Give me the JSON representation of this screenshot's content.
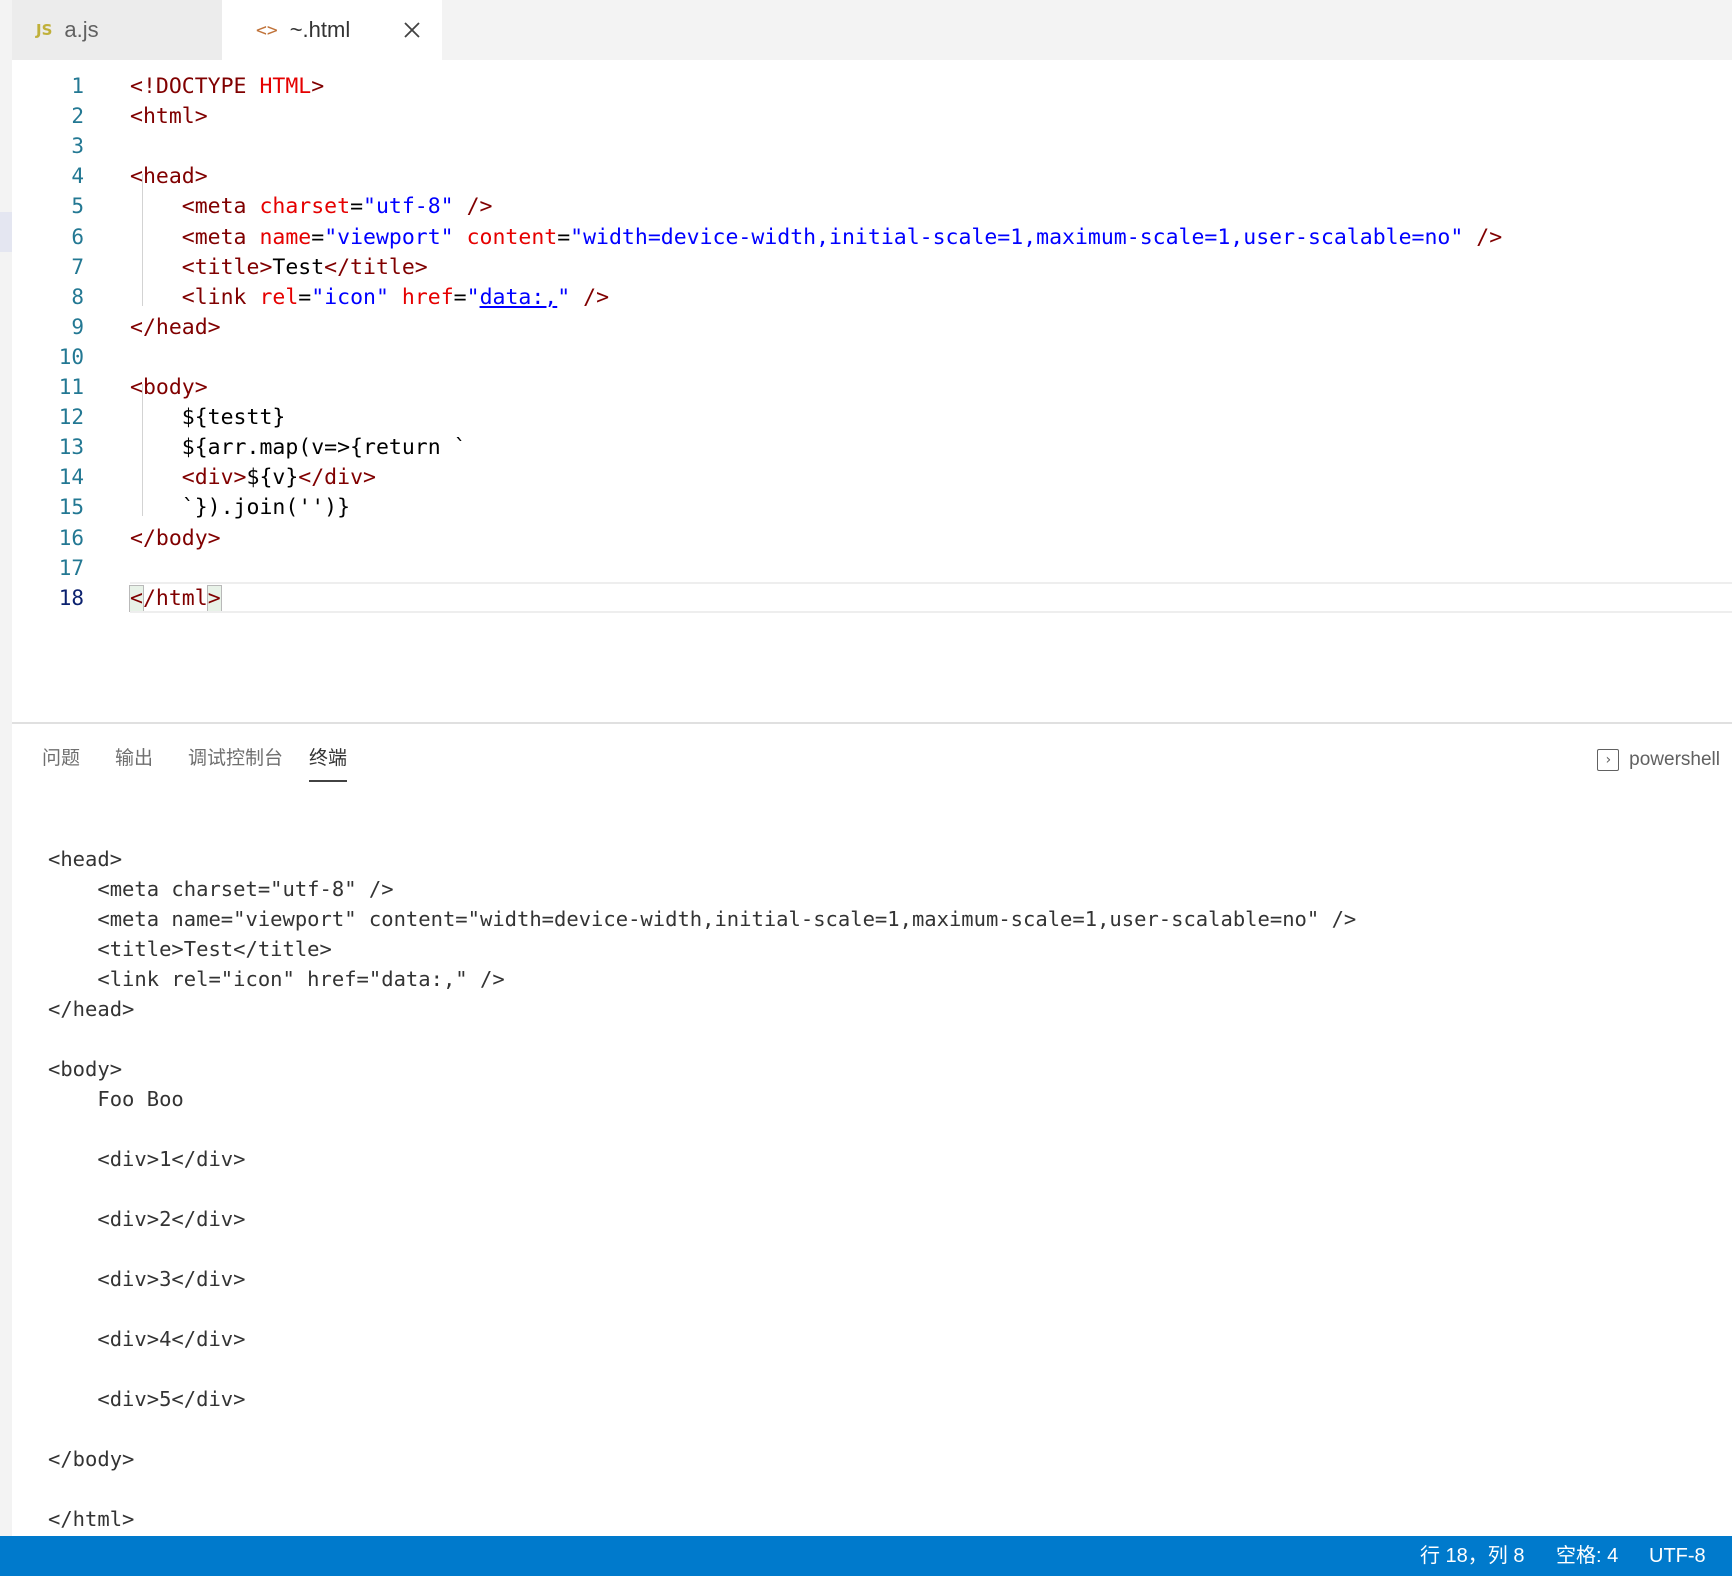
{
  "tabs": [
    {
      "label": "a.js",
      "icon_text": "JS",
      "icon": "javascript-file-icon"
    },
    {
      "label": "~.html",
      "icon_text": "<>",
      "icon": "html-file-icon",
      "close_icon": "close-icon"
    }
  ],
  "editor": {
    "lines": [
      {
        "n": "1",
        "tokens": [
          {
            "t": "<!DOCTYPE ",
            "c": "tag"
          },
          {
            "t": "HTML",
            "c": "attr"
          },
          {
            "t": ">",
            "c": "tag"
          }
        ]
      },
      {
        "n": "2",
        "tokens": [
          {
            "t": "<html>",
            "c": "tag"
          }
        ]
      },
      {
        "n": "3",
        "tokens": []
      },
      {
        "n": "4",
        "tokens": [
          {
            "t": "<head>",
            "c": "tag"
          }
        ]
      },
      {
        "n": "5",
        "tokens": [
          {
            "t": "    "
          },
          {
            "t": "<meta ",
            "c": "tag"
          },
          {
            "t": "charset",
            "c": "attr"
          },
          {
            "t": "="
          },
          {
            "t": "\"utf-8\"",
            "c": "val"
          },
          {
            "t": " />",
            "c": "tag"
          }
        ]
      },
      {
        "n": "6",
        "tokens": [
          {
            "t": "    "
          },
          {
            "t": "<meta ",
            "c": "tag"
          },
          {
            "t": "name",
            "c": "attr"
          },
          {
            "t": "="
          },
          {
            "t": "\"viewport\"",
            "c": "val"
          },
          {
            "t": " "
          },
          {
            "t": "content",
            "c": "attr"
          },
          {
            "t": "="
          },
          {
            "t": "\"width=device-width,initial-scale=1,maximum-scale=1,user-scalable=no\"",
            "c": "val"
          },
          {
            "t": " />",
            "c": "tag"
          }
        ]
      },
      {
        "n": "7",
        "tokens": [
          {
            "t": "    "
          },
          {
            "t": "<title>",
            "c": "tag"
          },
          {
            "t": "Test"
          },
          {
            "t": "</title>",
            "c": "tag"
          }
        ]
      },
      {
        "n": "8",
        "tokens": [
          {
            "t": "    "
          },
          {
            "t": "<link ",
            "c": "tag"
          },
          {
            "t": "rel",
            "c": "attr"
          },
          {
            "t": "="
          },
          {
            "t": "\"icon\"",
            "c": "val"
          },
          {
            "t": " "
          },
          {
            "t": "href",
            "c": "attr"
          },
          {
            "t": "="
          },
          {
            "t": "\"",
            "c": "val"
          },
          {
            "t": "data:,",
            "c": "link"
          },
          {
            "t": "\"",
            "c": "val"
          },
          {
            "t": " />",
            "c": "tag"
          }
        ]
      },
      {
        "n": "9",
        "tokens": [
          {
            "t": "</head>",
            "c": "tag"
          }
        ]
      },
      {
        "n": "10",
        "tokens": []
      },
      {
        "n": "11",
        "tokens": [
          {
            "t": "<body>",
            "c": "tag"
          }
        ]
      },
      {
        "n": "12",
        "tokens": [
          {
            "t": "    ${testt}"
          }
        ]
      },
      {
        "n": "13",
        "tokens": [
          {
            "t": "    ${arr.map(v=>{return `"
          }
        ]
      },
      {
        "n": "14",
        "tokens": [
          {
            "t": "    "
          },
          {
            "t": "<div>",
            "c": "tag"
          },
          {
            "t": "${v}"
          },
          {
            "t": "</div>",
            "c": "tag"
          }
        ]
      },
      {
        "n": "15",
        "tokens": [
          {
            "t": "    `}).join('')}"
          }
        ]
      },
      {
        "n": "16",
        "tokens": [
          {
            "t": "</body>",
            "c": "tag"
          }
        ]
      },
      {
        "n": "17",
        "tokens": []
      },
      {
        "n": "18",
        "tokens": [
          {
            "t": "<",
            "c": "tag",
            "m": true
          },
          {
            "t": "/html",
            "c": "tag"
          },
          {
            "t": ">",
            "c": "tag",
            "m": true
          }
        ],
        "current": true
      }
    ]
  },
  "panel": {
    "tabs": [
      "问题",
      "输出",
      "调试控制台",
      "终端"
    ],
    "active_tab": "终端",
    "shell_label": "powershell",
    "shell_icon": "terminal-icon",
    "terminal_lines": [
      "<head>",
      "    <meta charset=\"utf-8\" />",
      "    <meta name=\"viewport\" content=\"width=device-width,initial-scale=1,maximum-scale=1,user-scalable=no\" />",
      "    <title>Test</title>",
      "    <link rel=\"icon\" href=\"data:,\" />",
      "</head>",
      "",
      "<body>",
      "    Foo Boo",
      "",
      "    <div>1</div>",
      "",
      "    <div>2</div>",
      "",
      "    <div>3</div>",
      "",
      "    <div>4</div>",
      "",
      "    <div>5</div>",
      "",
      "</body>",
      "",
      "</html>"
    ]
  },
  "statusbar": {
    "cursor_position": "行 18，列 8",
    "indentation": "空格: 4",
    "encoding": "UTF-8"
  },
  "colors": {
    "statusbar": "#007acc",
    "line_number": "#237893",
    "tag": "#800000",
    "attribute": "#e50000",
    "value": "#0000ff"
  }
}
